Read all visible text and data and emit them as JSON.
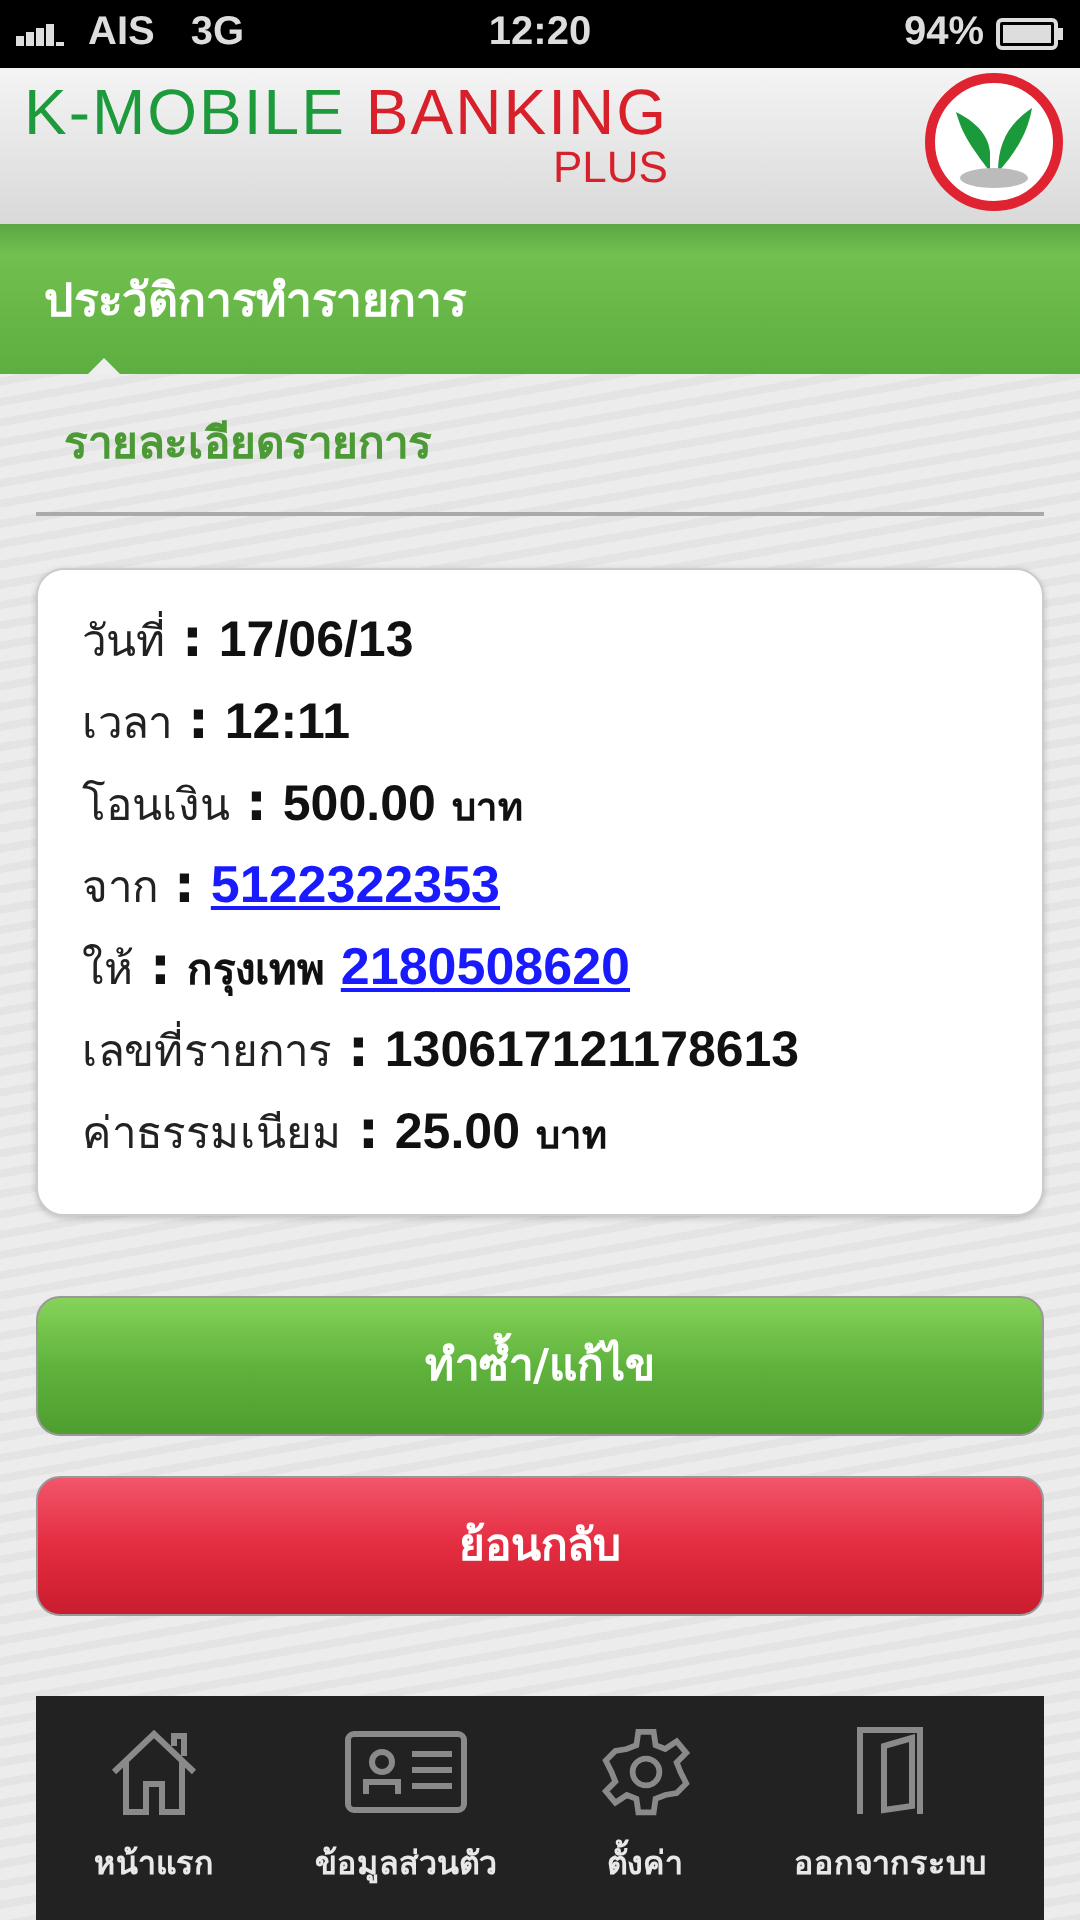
{
  "status_bar": {
    "carrier": "AIS",
    "network": "3G",
    "time": "12:20",
    "battery": "94%"
  },
  "header": {
    "logo_primary": "K-MOBILE",
    "logo_secondary": "BANKING",
    "logo_sub": "PLUS"
  },
  "section_title": "ประวัติการทำรายการ",
  "subtitle": "รายละเอียดรายการ",
  "details": [
    {
      "label": "วันที่",
      "sep": ":",
      "kind": "plain",
      "value": "17/06/13"
    },
    {
      "label": "เวลา",
      "sep": ":",
      "kind": "plain",
      "value": "12:11"
    },
    {
      "label": "โอนเงิน",
      "sep": ":",
      "kind": "plain",
      "value": "500.00",
      "unit": "บาท"
    },
    {
      "label": "จาก",
      "sep": ":",
      "kind": "link",
      "value": "5122322353"
    },
    {
      "label": "ให้",
      "sep": ":",
      "kind": "link",
      "bank": "กรุงเทพ",
      "value": "2180508620"
    },
    {
      "label": "เลขที่รายการ",
      "sep": ":",
      "kind": "plain",
      "value": "130617121178613"
    },
    {
      "label": "ค่าธรรมเนียม",
      "sep": ":",
      "kind": "plain",
      "value": "25.00",
      "unit": "บาท"
    }
  ],
  "buttons": [
    {
      "label": "ทำซ้ำ/แก้ไข",
      "kind": "primary"
    },
    {
      "label": "ย้อนกลับ",
      "kind": "danger"
    }
  ],
  "nav": [
    {
      "label": "หน้าแรก"
    },
    {
      "label": "ข้อมูลส่วนตัว"
    },
    {
      "label": "ตั้งค่า"
    },
    {
      "label": "ออกจากระบบ"
    }
  ]
}
